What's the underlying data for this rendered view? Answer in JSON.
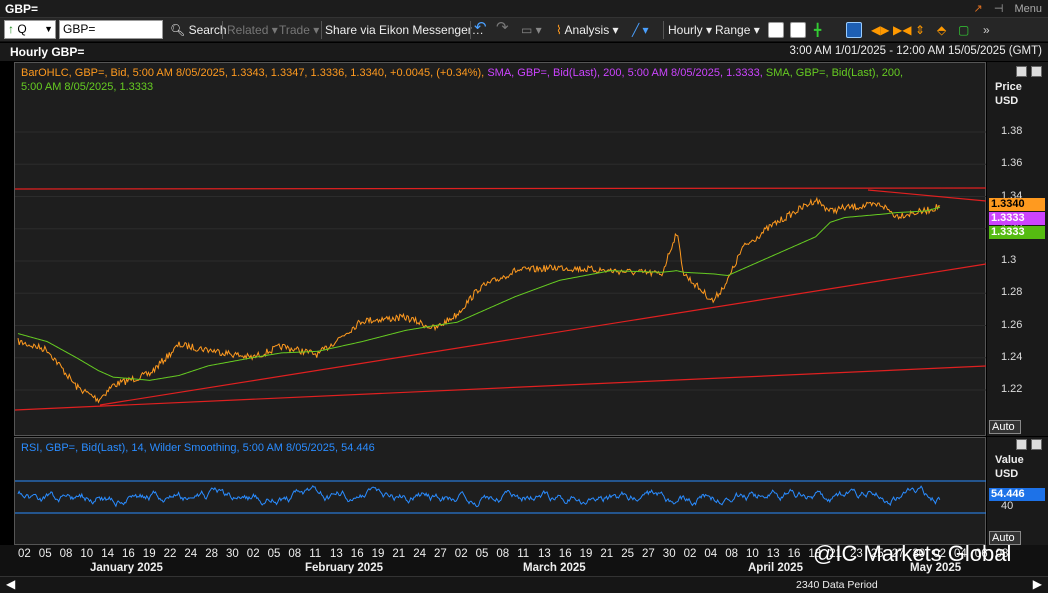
{
  "window": {
    "title": "GBP=",
    "menu_label": "Menu"
  },
  "toolbar": {
    "ric_prefix": "Q",
    "ric_value": "GBP=",
    "search": "Search",
    "related": "Related",
    "trade": "Trade",
    "share": "Share via Eikon Messenger…",
    "analysis": "Analysis",
    "interval": "Hourly",
    "range": "Range"
  },
  "chart": {
    "title": "Hourly GBP=",
    "date_range": "3:00 AM 1/01/2025 - 12:00 AM 15/05/2025 (GMT)",
    "legend_ohlc": "BarOHLC, GBP=, Bid,  5:00 AM 8/05/2025,  1.3343,  1.3347,  1.3336,  1.3340,  +0.0045,  (+0.34%),",
    "legend_sma1": "SMA, GBP=, Bid(Last),  200,  5:00 AM 8/05/2025,  1.3333,",
    "legend_sma2a": "SMA, GBP=, Bid(Last),  200,",
    "legend_sma2b": "5:00 AM 8/05/2025,  1.3333",
    "price_axis_title": "Price",
    "price_axis_unit": "USD",
    "price_ticks": [
      "1.38",
      "1.36",
      "1.34",
      "1.32",
      "1.3",
      "1.28",
      "1.26",
      "1.24",
      "1.22"
    ],
    "last_price": "1.3340",
    "sma_value_1": "1.3333",
    "sma_value_2": "1.3333",
    "auto_label": "Auto"
  },
  "rsi": {
    "legend": "RSI, GBP=, Bid(Last),  14,  Wilder Smoothing,  5:00 AM 8/05/2025,  54.446",
    "axis_title": "Value",
    "axis_unit": "USD",
    "tick": "40",
    "current_value": "54.446",
    "auto_label": "Auto"
  },
  "x_axis": {
    "days": [
      "02",
      "05",
      "08",
      "10",
      "14",
      "16",
      "19",
      "22",
      "24",
      "28",
      "30",
      "02",
      "05",
      "08",
      "11",
      "13",
      "16",
      "19",
      "21",
      "24",
      "27",
      "02",
      "05",
      "08",
      "11",
      "13",
      "16",
      "19",
      "21",
      "25",
      "27",
      "30",
      "02",
      "04",
      "08",
      "10",
      "13",
      "16",
      "18",
      "21",
      "23",
      "25",
      "27",
      "30",
      "02",
      "04",
      "06",
      "08"
    ],
    "months": [
      "January 2025",
      "February 2025",
      "March 2025",
      "April 2025",
      "May 2025"
    ]
  },
  "footer": {
    "period": "2340 Data Period",
    "watermark": "@IC Markets Global"
  },
  "colors": {
    "price": "#ff9a1f",
    "sma": "#66cc22",
    "sma_legend": "#cc44ff",
    "trend": "#e02020",
    "rsi": "#2a8cff",
    "rsi_band": "#2a8cff"
  },
  "chart_data": [
    {
      "type": "line",
      "title": "Hourly GBP=",
      "ylabel": "Price USD",
      "ylim": [
        1.2,
        1.39
      ],
      "x": [
        "2025-01-02",
        "2025-01-06",
        "2025-01-10",
        "2025-01-13",
        "2025-01-15",
        "2025-01-20",
        "2025-01-24",
        "2025-01-28",
        "2025-02-03",
        "2025-02-07",
        "2025-02-12",
        "2025-02-18",
        "2025-02-24",
        "2025-02-28",
        "2025-03-03",
        "2025-03-06",
        "2025-03-11",
        "2025-03-17",
        "2025-03-24",
        "2025-03-31",
        "2025-04-02",
        "2025-04-03",
        "2025-04-07",
        "2025-04-09",
        "2025-04-11",
        "2025-04-15",
        "2025-04-21",
        "2025-04-23",
        "2025-04-25",
        "2025-04-30",
        "2025-05-02",
        "2025-05-06",
        "2025-05-08"
      ],
      "series": [
        {
          "name": "BarOHLC, GBP=, Bid",
          "values": [
            1.25,
            1.245,
            1.222,
            1.214,
            1.223,
            1.23,
            1.248,
            1.245,
            1.24,
            1.247,
            1.242,
            1.263,
            1.265,
            1.258,
            1.267,
            1.283,
            1.294,
            1.296,
            1.294,
            1.292,
            1.318,
            1.292,
            1.275,
            1.288,
            1.308,
            1.322,
            1.338,
            1.331,
            1.333,
            1.335,
            1.328,
            1.331,
            1.334
          ]
        },
        {
          "name": "SMA, GBP=, Bid(Last), 200",
          "values": [
            1.255,
            1.25,
            1.24,
            1.232,
            1.228,
            1.226,
            1.229,
            1.235,
            1.24,
            1.243,
            1.244,
            1.25,
            1.257,
            1.26,
            1.262,
            1.268,
            1.278,
            1.288,
            1.294,
            1.293,
            1.294,
            1.293,
            1.292,
            1.291,
            1.295,
            1.303,
            1.315,
            1.324,
            1.327,
            1.329,
            1.33,
            1.331,
            1.3333
          ]
        }
      ]
    },
    {
      "type": "line",
      "title": "RSI, GBP=, Bid(Last), 14, Wilder Smoothing",
      "ylabel": "Value",
      "series": [
        {
          "name": "RSI",
          "values": [
            54.4
          ]
        }
      ]
    }
  ]
}
